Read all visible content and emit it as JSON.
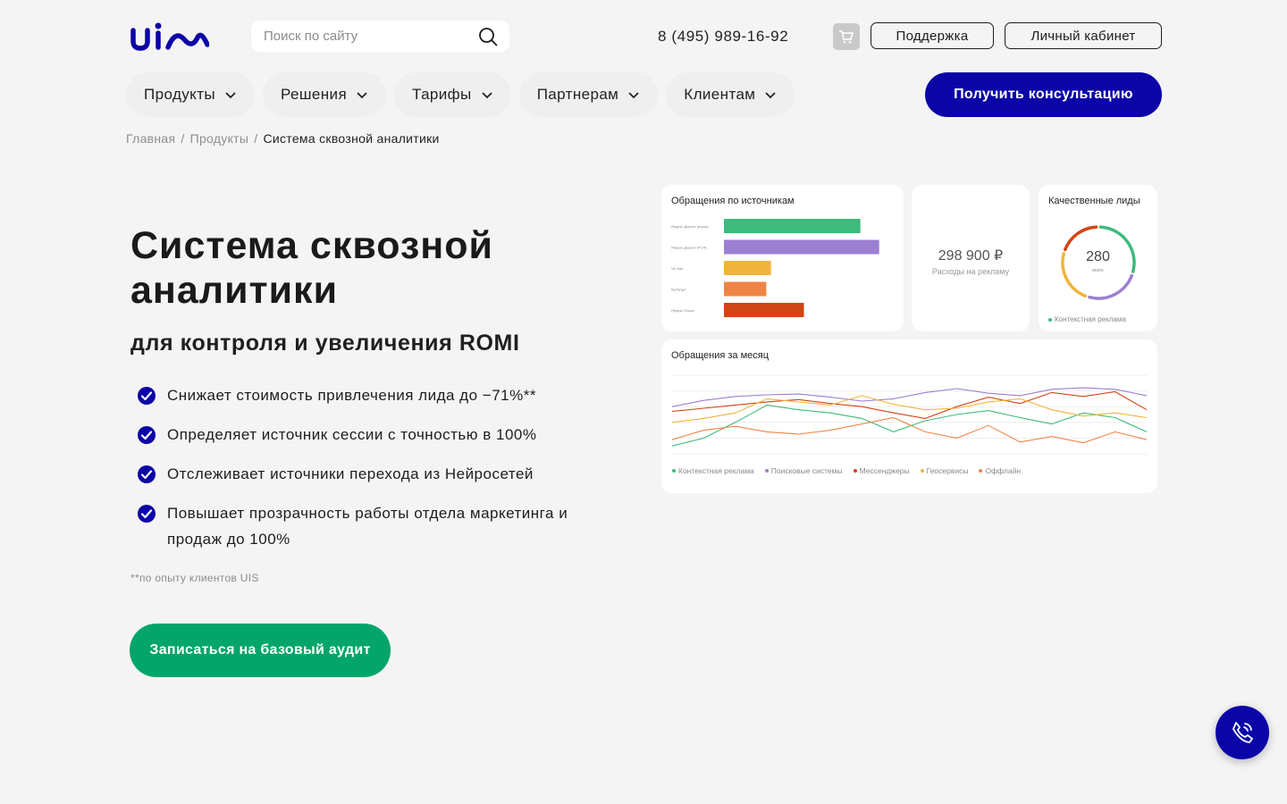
{
  "header": {
    "search_placeholder": "Поиск по сайту",
    "phone": "8 (495) 989-16-92",
    "support_label": "Поддержка",
    "cabinet_label": "Личный кабинет"
  },
  "nav": {
    "items": [
      {
        "label": "Продукты"
      },
      {
        "label": "Решения"
      },
      {
        "label": "Тарифы"
      },
      {
        "label": "Партнерам"
      },
      {
        "label": "Клиентам"
      }
    ],
    "cta_label": "Получить консультацию"
  },
  "breadcrumb": {
    "home": "Главная",
    "sep": "/",
    "products": "Продукты",
    "current": "Система сквозной аналитики"
  },
  "hero": {
    "title": "Система сквозной аналитики",
    "subtitle": "для контроля и увеличения ROMI",
    "features": [
      "Снижает стоимость привлечения лида до −71%**",
      "Определяет источник сессии с точностью в 100%",
      "Отслеживает источники перехода из Нейросетей",
      "Повышает прозрачность работы отдела маркетинга и продаж до 100%"
    ],
    "note": "**по опыту клиентов UIS",
    "cta_label": "Записаться на базовый аудит"
  },
  "dashboard": {
    "sources_title": "Обращения по источникам",
    "spend_value": "298 900 ₽",
    "spend_label": "Расходы на рекламу",
    "leads_title": "Качественные лиды",
    "leads_value": "280",
    "leads_sub": "всего",
    "leads_legend": "Контекстная реклама",
    "month_title": "Обращения за месяц"
  },
  "chart_data": [
    {
      "type": "bar",
      "title": "Обращения по источникам",
      "orientation": "horizontal",
      "categories": [
        "Яндекс.Директ (поиск)",
        "Яндекс.Директ (РСЯ)",
        "VK Ads",
        "MyTarget",
        "Яндекс.Поиск"
      ],
      "values": [
        145,
        165,
        50,
        45,
        85
      ],
      "colors": [
        "#3dba7d",
        "#9b7fd1",
        "#f0b43c",
        "#ef8544",
        "#d24413"
      ],
      "xlim": [
        0,
        190
      ]
    },
    {
      "type": "pie",
      "title": "Качественные лиды",
      "total": "280",
      "values": [
        30,
        25,
        25,
        20
      ],
      "colors": [
        "#3dba7d",
        "#9b7fd1",
        "#f0b43c",
        "#d24413"
      ]
    },
    {
      "type": "line",
      "title": "Обращения за месяц",
      "x": [
        1,
        2,
        3,
        4,
        5,
        6,
        7,
        8,
        9,
        10,
        11,
        12,
        13,
        14,
        15,
        16
      ],
      "series": [
        {
          "name": "Контекстная реклама",
          "color": "#3dba7d",
          "values": [
            10,
            20,
            40,
            62,
            56,
            52,
            45,
            28,
            42,
            50,
            55,
            46,
            38,
            52,
            46,
            28
          ]
        },
        {
          "name": "Поисковые системы",
          "color": "#9b7fd1",
          "values": [
            60,
            68,
            73,
            75,
            76,
            72,
            67,
            70,
            78,
            83,
            77,
            74,
            82,
            84,
            82,
            74
          ]
        },
        {
          "name": "Мессенджеры",
          "color": "#d24413",
          "values": [
            54,
            58,
            62,
            66,
            69,
            64,
            60,
            52,
            45,
            60,
            72,
            64,
            78,
            73,
            79,
            56
          ]
        },
        {
          "name": "Геосервисы",
          "color": "#f0b43c",
          "values": [
            40,
            45,
            52,
            70,
            66,
            62,
            74,
            63,
            56,
            58,
            66,
            70,
            56,
            48,
            52,
            46
          ]
        },
        {
          "name": "Оффлайн",
          "color": "#ef8544",
          "values": [
            18,
            30,
            35,
            28,
            25,
            30,
            38,
            46,
            28,
            20,
            36,
            15,
            22,
            14,
            28,
            18
          ]
        }
      ],
      "ylim": [
        0,
        100
      ]
    }
  ]
}
